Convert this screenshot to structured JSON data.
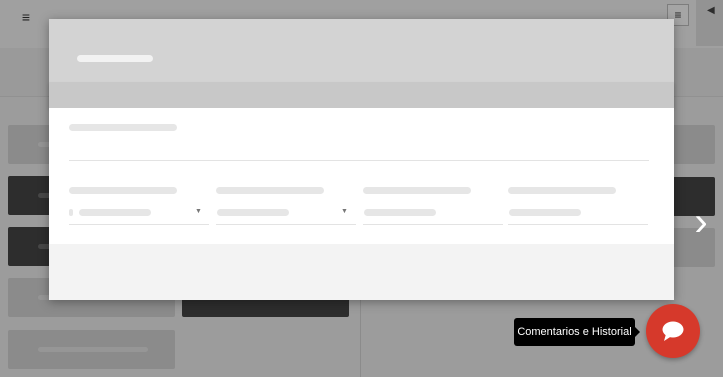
{
  "header": {
    "menu_icon": "hamburger-icon",
    "list_icon": "list-icon",
    "side_toggle_icon": "caret-left-icon"
  },
  "modal": {
    "state": "loading-placeholder"
  },
  "carousel": {
    "next_icon": "chevron-right-icon"
  },
  "chat": {
    "tooltip": "Comentarios e Historial",
    "icon": "chat-bubble-icon",
    "accent": "#d6392b"
  }
}
